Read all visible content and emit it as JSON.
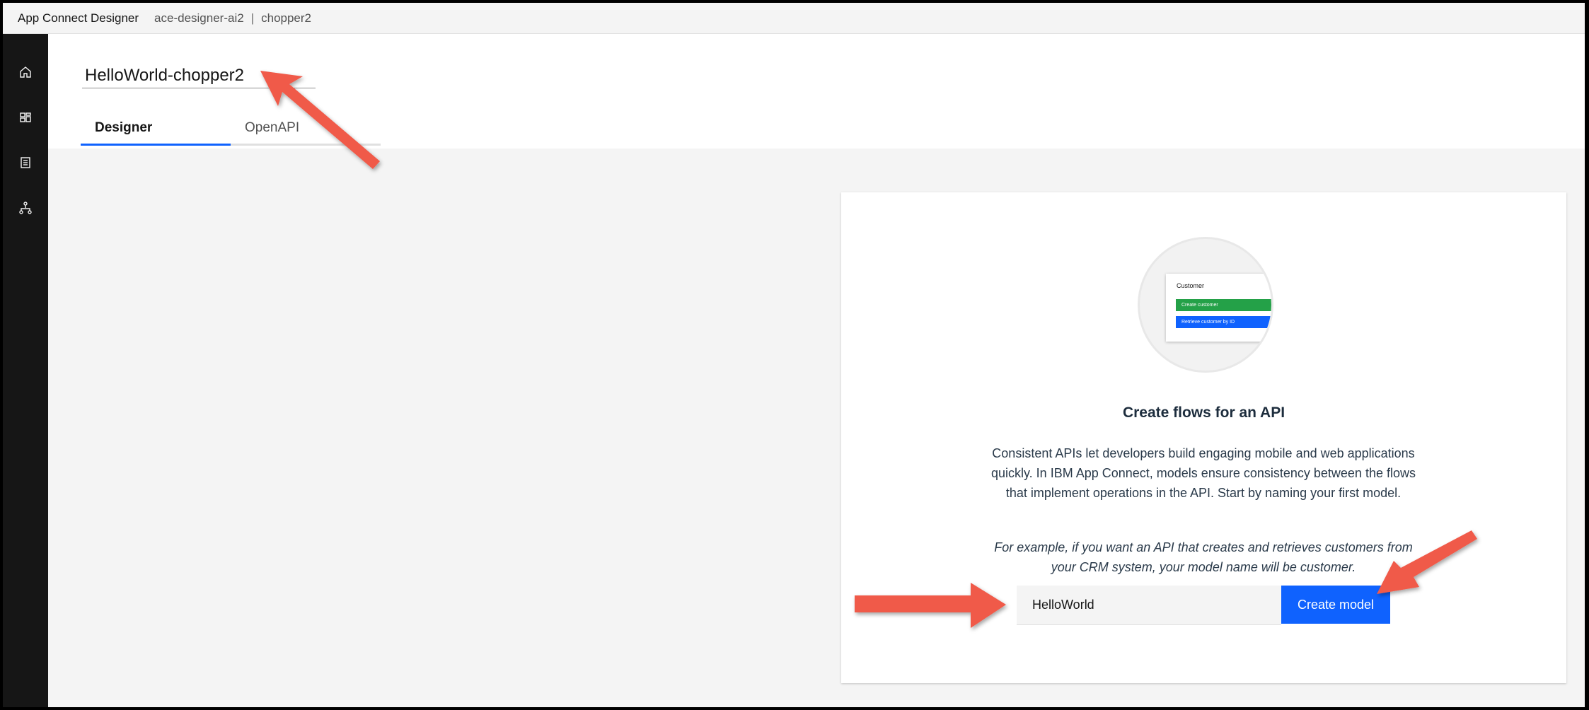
{
  "topbar": {
    "app_name": "App Connect Designer",
    "instance": "ace-designer-ai2",
    "separator": "|",
    "user": "chopper2"
  },
  "sidenav": {
    "items": [
      {
        "icon": "home-icon"
      },
      {
        "icon": "dashboard-icon"
      },
      {
        "icon": "catalog-icon"
      },
      {
        "icon": "hierarchy-icon"
      }
    ]
  },
  "flow": {
    "title": "HelloWorld-chopper2"
  },
  "tabs": [
    {
      "label": "Designer",
      "active": true
    },
    {
      "label": "OpenAPI",
      "active": false
    }
  ],
  "card": {
    "illustration": {
      "title": "Customer",
      "button1": "Create customer",
      "button2": "Retrieve customer by ID"
    },
    "heading": "Create flows for an API",
    "description": "Consistent APIs let developers build engaging mobile and web applications quickly. In IBM App Connect, models ensure consistency between the flows that implement operations in the API. Start by naming your first model.",
    "example": "For example, if you want an API that creates and retrieves customers from your CRM system, your model name will be customer.",
    "model_input_value": "HelloWorld",
    "create_button": "Create model"
  },
  "colors": {
    "primary": "#0f62fe",
    "success": "#24a148",
    "annotation_arrow": "#f05a4a",
    "sidenav_bg": "#161616"
  }
}
